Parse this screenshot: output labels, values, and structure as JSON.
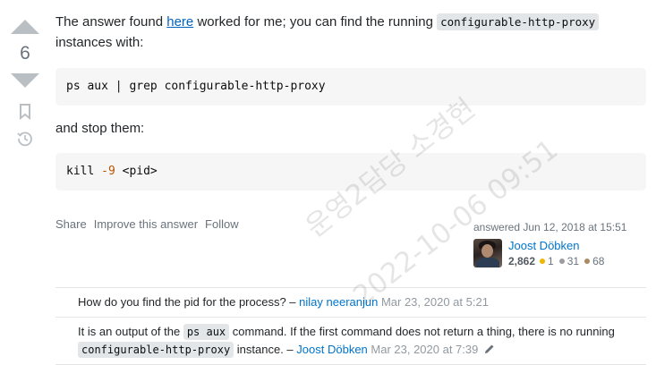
{
  "vote": {
    "count": "6"
  },
  "post": {
    "intro_before": "The answer found ",
    "intro_link": "here",
    "intro_after": " worked for me; you can find the running ",
    "intro_code": "configurable-http-proxy",
    "intro_end": " instances with:",
    "code1": "ps aux | grep configurable-http-proxy",
    "stop_text": "and stop them:",
    "code2_cmd": "kill ",
    "code2_num": "-9",
    "code2_arg": " <pid>"
  },
  "actions": {
    "share": "Share",
    "improve": "Improve this answer",
    "follow": "Follow"
  },
  "signature": {
    "answered": "answered Jun 12, 2018 at 15:51",
    "user_name": "Joost Döbken",
    "reputation": "2,862",
    "gold": "1",
    "silver": "31",
    "bronze": "68"
  },
  "comments": [
    {
      "text": "How do you find the pid for the process? – ",
      "user": "nilay neeranjun",
      "date": " Mar 23, 2020 at 5:21"
    },
    {
      "text_a": "It is an output of the ",
      "code_a": "ps aux",
      "text_b": " command. If the first command does not return a thing, there is no running ",
      "code_b": "configurable-http-proxy",
      "text_c": " instance. – ",
      "user": "Joost Döbken",
      "date": " Mar 23, 2020 at 7:39"
    }
  ],
  "watermark": {
    "line1": "운영2담당 소경현",
    "line2": "2022-10-06 09:51"
  },
  "colors": {
    "link": "#0063bf",
    "gold": "#f1b600",
    "silver": "#9a9c9f",
    "bronze": "#ab8a5f"
  }
}
